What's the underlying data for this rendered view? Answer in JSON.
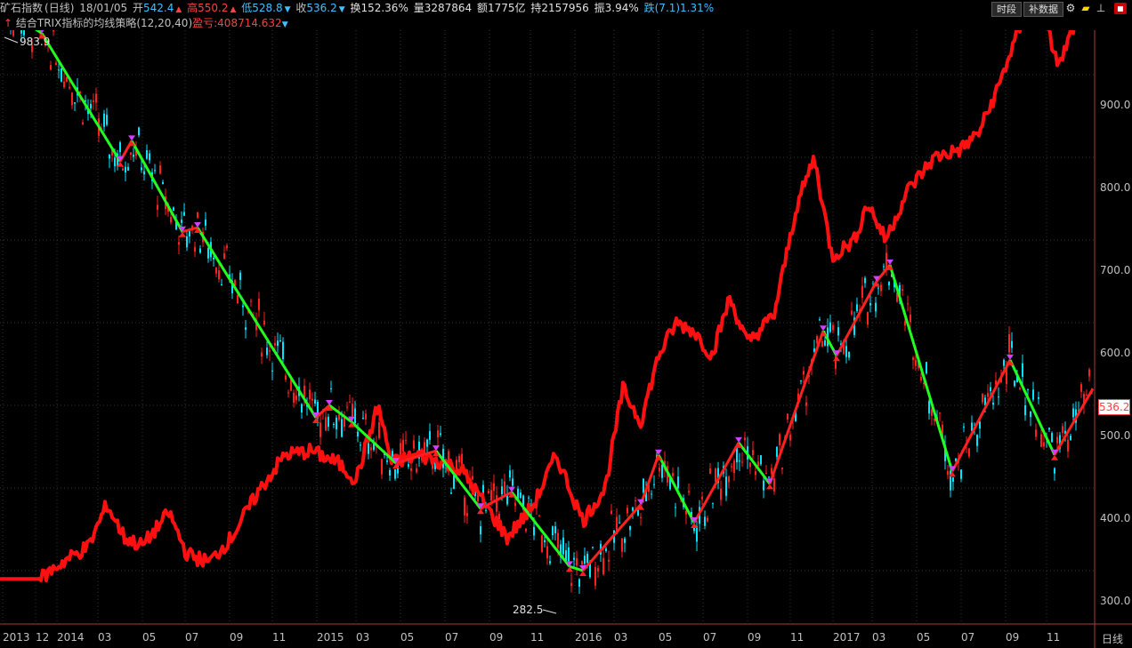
{
  "header": {
    "title": "矿石指数",
    "period": "(日线)",
    "date": "18/01/05",
    "open_label": "开",
    "open": "542.4",
    "high_label": "高",
    "high": "550.2",
    "low_label": "低",
    "low": "528.8",
    "close_label": "收",
    "close": "536.2",
    "turnover": "换152.36%",
    "volume": "量3287864",
    "amount": "额1775亿",
    "oi": "持2157956",
    "amp": "振3.94%",
    "change": "跌(7.1)1.31%"
  },
  "strategy": {
    "name": "结合TRIX指标的均线策略(12,20,40)",
    "pnl": "盈亏:408714.632"
  },
  "toolbar": {
    "period_btn": "时段",
    "supplement_btn": "补数据"
  },
  "colors": {
    "up": "#ff2020",
    "down": "#00e5ff",
    "uptrend": "#ff2020",
    "downtrend": "#20ff20",
    "equity": "#ff1010",
    "grid": "#333333",
    "text": "#c0c0c0"
  },
  "y_axis": {
    "ticks": [
      "900.0",
      "800.0",
      "700.0",
      "600.0",
      "500.0",
      "400.0",
      "300.0"
    ],
    "current": "536.2"
  },
  "x_axis": {
    "ticks": [
      "2013",
      "12",
      "2014",
      "03",
      "05",
      "07",
      "09",
      "11",
      "2015",
      "03",
      "05",
      "07",
      "09",
      "11",
      "2016",
      "03",
      "05",
      "07",
      "09",
      "11",
      "2017",
      "03",
      "05",
      "07",
      "09",
      "11"
    ],
    "period_label": "日线"
  },
  "annotations": {
    "high_label": "983.9",
    "low_label": "282.5"
  },
  "chart_data": {
    "type": "line",
    "x_label": "",
    "ylim": [
      270,
      1000
    ],
    "series": [
      {
        "name": "",
        "points": [
          [
            0,
            983.9
          ],
          [
            47,
            950
          ],
          [
            135,
            795
          ],
          [
            148,
            820
          ],
          [
            205,
            710
          ],
          [
            222,
            715
          ],
          [
            355,
            485
          ],
          [
            370,
            500
          ],
          [
            395,
            480
          ],
          [
            445,
            430
          ],
          [
            490,
            445
          ],
          [
            540,
            375
          ],
          [
            575,
            395
          ],
          [
            640,
            305
          ],
          [
            655,
            300
          ],
          [
            720,
            380
          ],
          [
            740,
            440
          ],
          [
            780,
            358
          ],
          [
            830,
            455
          ],
          [
            865,
            405
          ],
          [
            925,
            590
          ],
          [
            940,
            560
          ],
          [
            985,
            650
          ],
          [
            1000,
            670
          ],
          [
            1070,
            420
          ],
          [
            1135,
            555
          ],
          [
            1185,
            440
          ],
          [
            1228,
            520
          ]
        ]
      },
      {
        "name": "",
        "points": [
          [
            0,
            290
          ],
          [
            45,
            290
          ],
          [
            70,
            310
          ],
          [
            100,
            330
          ],
          [
            120,
            380
          ],
          [
            140,
            340
          ],
          [
            160,
            330
          ],
          [
            190,
            370
          ],
          [
            210,
            320
          ],
          [
            235,
            310
          ],
          [
            260,
            340
          ],
          [
            290,
            395
          ],
          [
            320,
            440
          ],
          [
            350,
            445
          ],
          [
            380,
            430
          ],
          [
            400,
            410
          ],
          [
            425,
            500
          ],
          [
            440,
            430
          ],
          [
            470,
            440
          ],
          [
            500,
            430
          ],
          [
            520,
            420
          ],
          [
            545,
            380
          ],
          [
            570,
            340
          ],
          [
            600,
            380
          ],
          [
            625,
            440
          ],
          [
            655,
            360
          ],
          [
            680,
            400
          ],
          [
            700,
            520
          ],
          [
            720,
            480
          ],
          [
            740,
            560
          ],
          [
            760,
            600
          ],
          [
            780,
            590
          ],
          [
            800,
            560
          ],
          [
            820,
            630
          ],
          [
            840,
            575
          ],
          [
            870,
            610
          ],
          [
            895,
            740
          ],
          [
            915,
            800
          ],
          [
            935,
            680
          ],
          [
            960,
            700
          ],
          [
            975,
            745
          ],
          [
            995,
            700
          ],
          [
            1020,
            760
          ],
          [
            1050,
            800
          ],
          [
            1080,
            810
          ],
          [
            1100,
            830
          ],
          [
            1120,
            880
          ],
          [
            1140,
            940
          ],
          [
            1160,
            990
          ],
          [
            1175,
            960
          ],
          [
            1190,
            910
          ],
          [
            1210,
            970
          ],
          [
            1230,
            975
          ]
        ]
      }
    ]
  }
}
